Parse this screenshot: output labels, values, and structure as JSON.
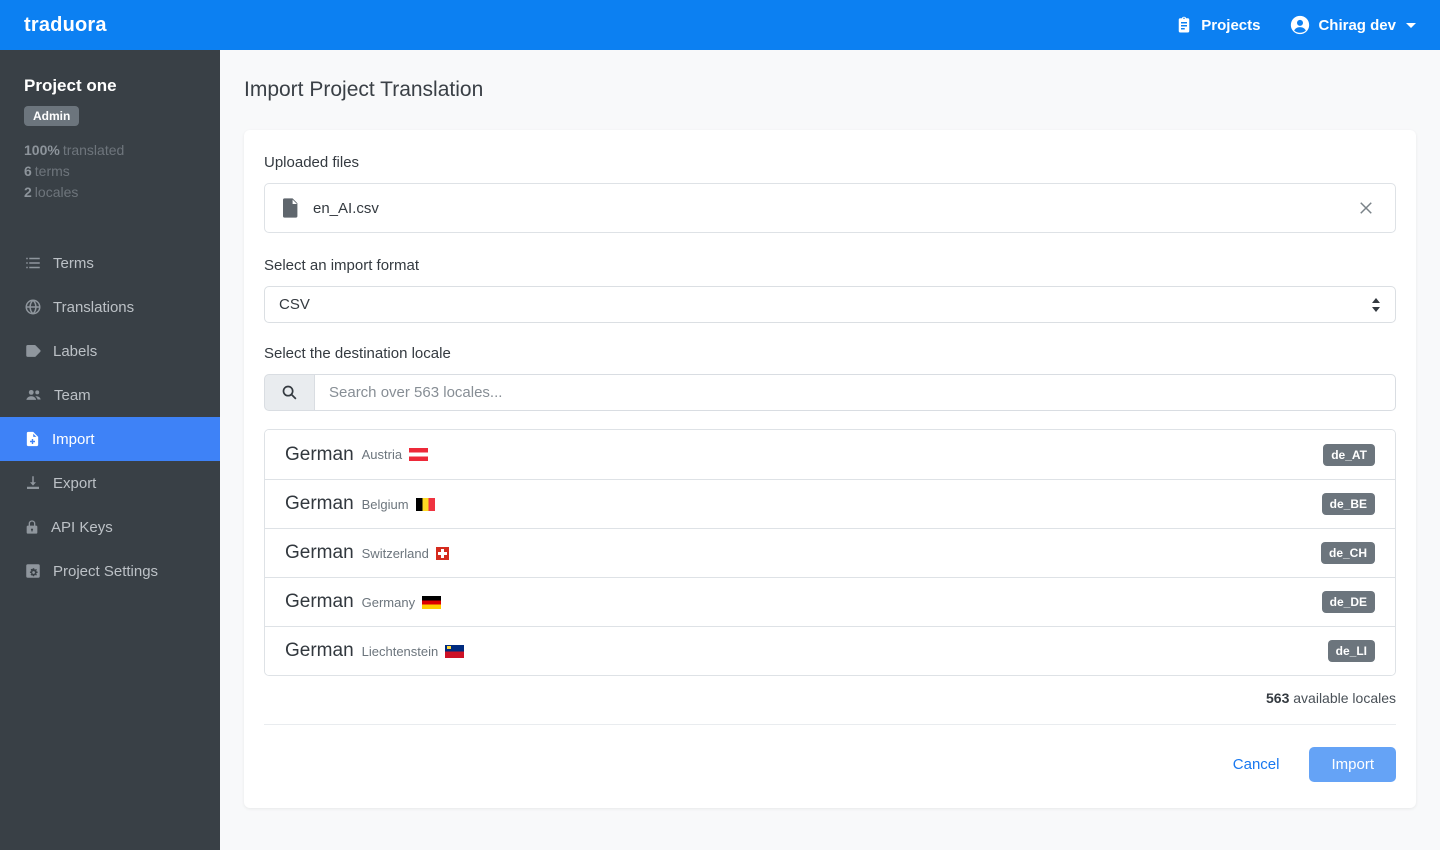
{
  "navbar": {
    "brand": "traduora",
    "projects_label": "Projects",
    "user_label": "Chirag dev"
  },
  "sidebar": {
    "project_name": "Project one",
    "role_badge": "Admin",
    "stats": [
      {
        "value": "100%",
        "label": "translated"
      },
      {
        "value": "6",
        "label": "terms"
      },
      {
        "value": "2",
        "label": "locales"
      }
    ],
    "items": [
      {
        "label": "Terms",
        "icon": "list-icon",
        "active": false
      },
      {
        "label": "Translations",
        "icon": "globe-icon",
        "active": false
      },
      {
        "label": "Labels",
        "icon": "label-icon",
        "active": false
      },
      {
        "label": "Team",
        "icon": "people-icon",
        "active": false
      },
      {
        "label": "Import",
        "icon": "file-plus-icon",
        "active": true
      },
      {
        "label": "Export",
        "icon": "download-icon",
        "active": false
      },
      {
        "label": "API Keys",
        "icon": "lock-icon",
        "active": false
      },
      {
        "label": "Project Settings",
        "icon": "gear-icon",
        "active": false
      }
    ]
  },
  "main": {
    "title": "Import Project Translation",
    "uploaded_files_label": "Uploaded files",
    "file_name": "en_AI.csv",
    "format_label": "Select an import format",
    "format_value": "CSV",
    "destination_label": "Select the destination locale",
    "search_placeholder": "Search over 563 locales...",
    "locales": [
      {
        "language": "German",
        "region": "Austria",
        "code": "de_AT",
        "flag": "austria"
      },
      {
        "language": "German",
        "region": "Belgium",
        "code": "de_BE",
        "flag": "belgium"
      },
      {
        "language": "German",
        "region": "Switzerland",
        "code": "de_CH",
        "flag": "switzerland"
      },
      {
        "language": "German",
        "region": "Germany",
        "code": "de_DE",
        "flag": "germany"
      },
      {
        "language": "German",
        "region": "Liechtenstein",
        "code": "de_LI",
        "flag": "liechtenstein"
      }
    ],
    "available_count": "563",
    "available_label": "available locales",
    "cancel_label": "Cancel",
    "import_label": "Import"
  },
  "colors": {
    "navbar_blue": "#0c80f2",
    "active_item_blue": "#3e82f7",
    "import_button_blue": "#65a3f6",
    "sidebar_dark": "#394046",
    "badge_gray": "#6c757d"
  }
}
